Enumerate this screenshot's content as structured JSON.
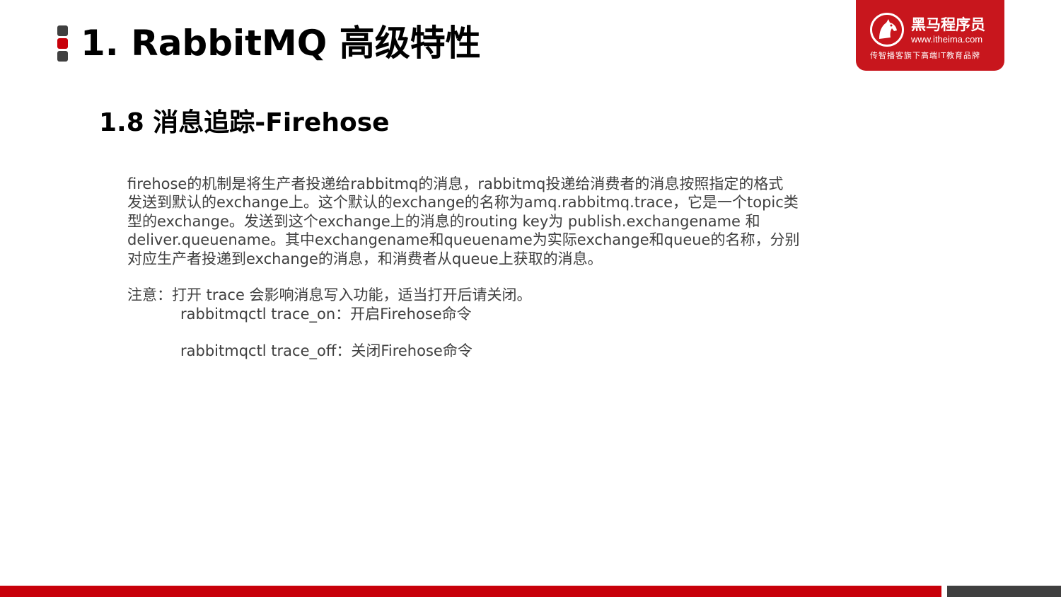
{
  "header": {
    "title": "1. RabbitMQ 高级特性",
    "marker_colors": [
      "#404040",
      "#c8000a",
      "#404040"
    ]
  },
  "logo": {
    "brand": "黑马程序员",
    "url": "www.itheima.com",
    "tagline": "传智播客旗下高端IT教育品牌",
    "icon": "horse-head-icon",
    "background_color": "#c8161d"
  },
  "section": {
    "title": "1.8 消息追踪-Firehose"
  },
  "body": {
    "lines": [
      "firehose的机制是将生产者投递给rabbitmq的消息，rabbitmq投递给消费者的消息按照指定的格式",
      "发送到默认的exchange上。这个默认的exchange的名称为amq.rabbitmq.trace，它是一个topic类",
      "型的exchange。发送到这个exchange上的消息的routing key为 publish.exchangename 和",
      "deliver.queuename。其中exchangename和queuename为实际exchange和queue的名称，分别",
      "对应生产者投递到exchange的消息，和消费者从queue上获取的消息。"
    ],
    "note": "注意：打开 trace 会影响消息写入功能，适当打开后请关闭。",
    "commands": [
      "rabbitmqctl trace_on：开启Firehose命令",
      "rabbitmqctl trace_off：关闭Firehose命令"
    ]
  },
  "footer": {
    "red_color": "#c8000a",
    "gray_color": "#3f3f3f"
  }
}
